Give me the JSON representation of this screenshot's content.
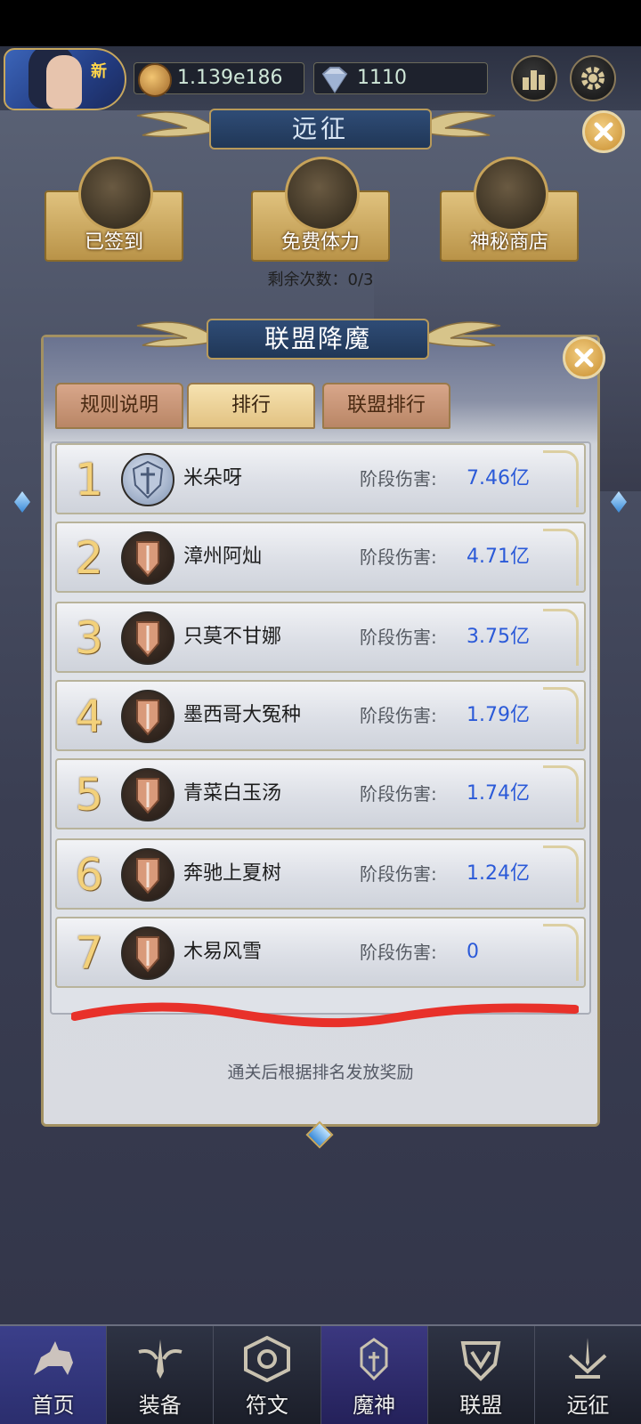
{
  "topbar": {
    "avatar_badge": "新",
    "gold": "1.139e186",
    "diamonds": "1110"
  },
  "expedition": {
    "title": "远征",
    "features": [
      {
        "label": "已签到",
        "icon": "scroll-quill-icon"
      },
      {
        "label": "免费体力",
        "icon": "scroll-quill-icon"
      },
      {
        "label": "神秘商店",
        "icon": "hooded-merchant-icon"
      }
    ],
    "remaining_text": "剩余次数：0/3"
  },
  "alliance": {
    "title": "联盟降魔",
    "tabs": [
      {
        "label": "规则说明",
        "active": false
      },
      {
        "label": "排行",
        "active": true
      },
      {
        "label": "联盟排行",
        "active": false
      }
    ],
    "damage_label": "阶段伤害:",
    "rankings": [
      {
        "rank": "1",
        "name": "米朵呀",
        "damage": "7.46亿",
        "badge": "silver"
      },
      {
        "rank": "2",
        "name": "漳州阿灿",
        "damage": "4.71亿",
        "badge": "bronze"
      },
      {
        "rank": "3",
        "name": "只莫不甘娜",
        "damage": "3.75亿",
        "badge": "bronze"
      },
      {
        "rank": "4",
        "name": "墨西哥大冤种",
        "damage": "1.79亿",
        "badge": "bronze"
      },
      {
        "rank": "5",
        "name": "青菜白玉汤",
        "damage": "1.74亿",
        "badge": "bronze"
      },
      {
        "rank": "6",
        "name": "奔驰上夏树",
        "damage": "1.24亿",
        "badge": "bronze"
      },
      {
        "rank": "7",
        "name": "木易风雪",
        "damage": "0",
        "badge": "bronze"
      }
    ],
    "reward_note": "通关后根据排名发放奖励"
  },
  "bottom_nav": [
    {
      "label": "首页",
      "icon": "rider-icon"
    },
    {
      "label": "装备",
      "icon": "sword-wings-icon"
    },
    {
      "label": "符文",
      "icon": "rune-hexagon-icon"
    },
    {
      "label": "魔神",
      "icon": "demon-helmet-icon"
    },
    {
      "label": "联盟",
      "icon": "alliance-shield-icon"
    },
    {
      "label": "远征",
      "icon": "expedition-swords-icon"
    }
  ],
  "colors": {
    "damage_value": "#2b5ad8",
    "rank_number": "#f3d17b",
    "scribble": "#e8312a"
  }
}
